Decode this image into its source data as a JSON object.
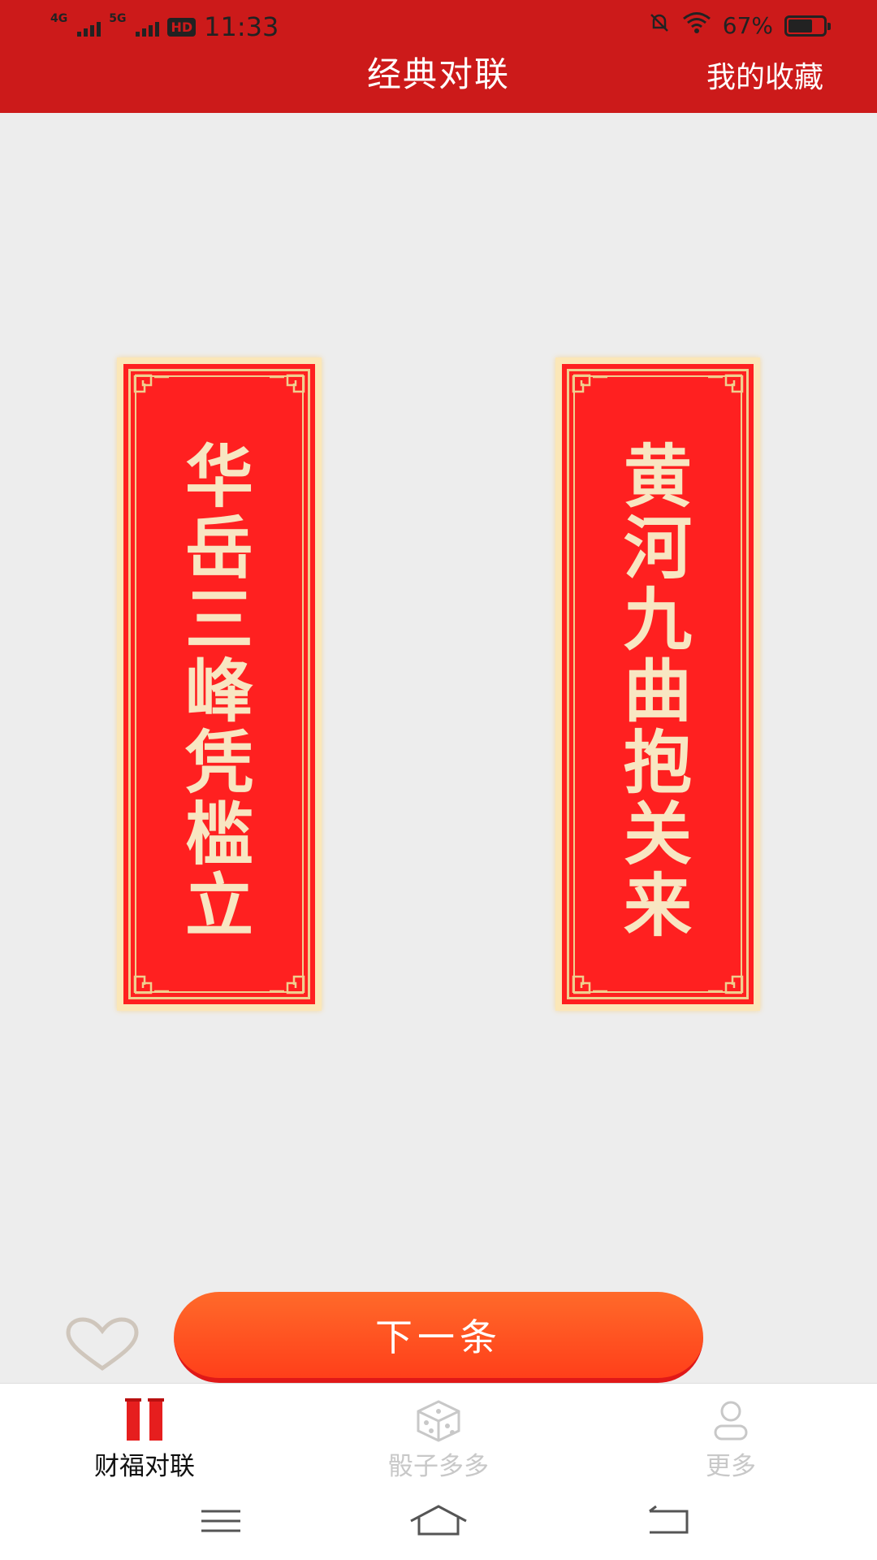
{
  "status_bar": {
    "network1": "4G",
    "network2": "5G",
    "hd": "HD",
    "time": "11:33",
    "battery": "67%"
  },
  "header": {
    "title": "经典对联",
    "favorites_link": "我的收藏"
  },
  "couplet": {
    "left": [
      "华",
      "岳",
      "三",
      "峰",
      "凭",
      "槛",
      "立"
    ],
    "right": [
      "黄",
      "河",
      "九",
      "曲",
      "抱",
      "关",
      "来"
    ]
  },
  "actions": {
    "next_label": "下一条"
  },
  "tabs": [
    {
      "label": "财福对联",
      "icon": "couplet-icon",
      "active": true
    },
    {
      "label": "骰子多多",
      "icon": "dice-icon",
      "active": false
    },
    {
      "label": "更多",
      "icon": "person-icon",
      "active": false
    }
  ],
  "colors": {
    "header": "#cc1a1a",
    "couplet_red": "#ff2020",
    "couplet_text": "#f8e6c2",
    "button": "#ff4a1e"
  }
}
